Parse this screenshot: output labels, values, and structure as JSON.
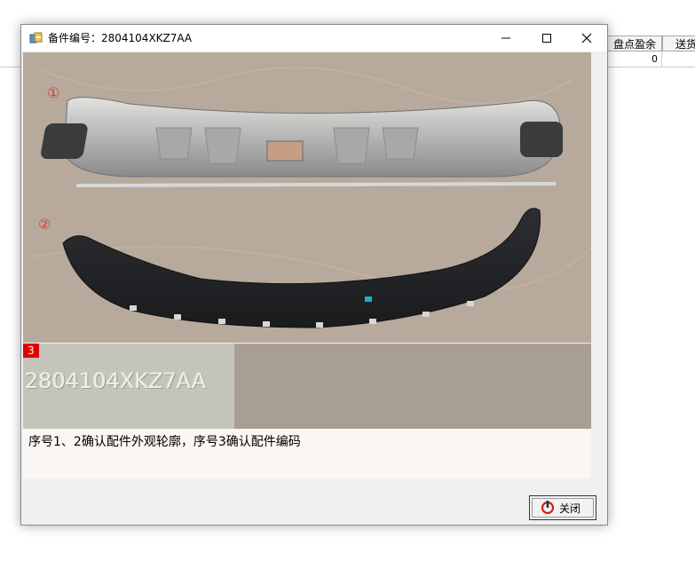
{
  "background_grid": {
    "headers": [
      "盘点盈余",
      "送货"
    ],
    "row_value": "0"
  },
  "dialog": {
    "title": "备件编号：2804104XKZ7AA",
    "markers": [
      "①",
      "②",
      "3"
    ],
    "code_plate_text": "2804104XKZ7AA",
    "caption": "序号1、2确认配件外观轮廓，序号3确认配件编码",
    "close_label": "关闭",
    "icons": [
      "app-icon",
      "minimize-icon",
      "maximize-icon",
      "close-icon",
      "power-icon"
    ]
  },
  "colors": {
    "marker_red": "#d83a3a",
    "tag_red": "#e00000",
    "photo_bg": "#b7a99c"
  }
}
